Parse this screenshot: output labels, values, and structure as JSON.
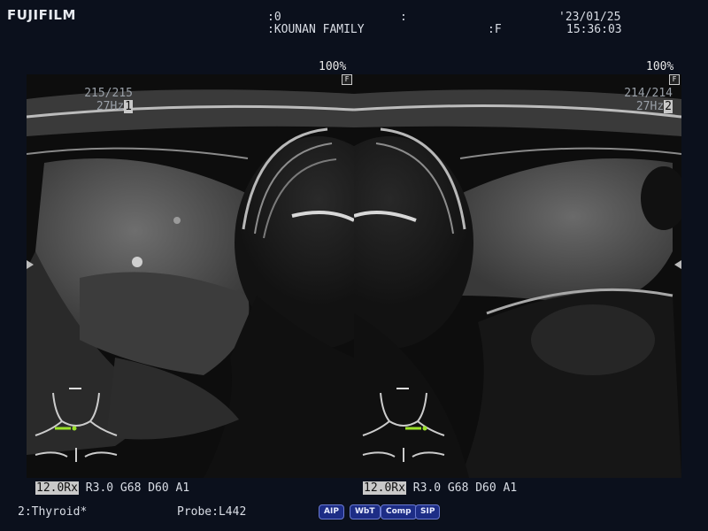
{
  "brand": "FUJIFILM",
  "header": {
    "id_value": ":0",
    "colon_mark": ":",
    "patient_name": ":KOUNAN FAMILY",
    "sex": ":F",
    "date": "'23/01/25",
    "time": "15:36:03"
  },
  "panes": [
    {
      "zoom": "100%",
      "f_marker": "F",
      "frame": "215/215",
      "rate": "27Hz",
      "index": "1",
      "params_highlight": "12.0Rx",
      "params": " R3.0 G68 D60 A1"
    },
    {
      "zoom": "100%",
      "f_marker": "F",
      "frame": "214/214",
      "rate": "27Hz",
      "index": "2",
      "params_highlight": "12.0Rx",
      "params": " R3.0 G68 D60 A1"
    }
  ],
  "footer": {
    "preset": "2:Thyroid*",
    "probe": "Probe:L442",
    "chips": [
      "AIP",
      "WbT",
      "Comp",
      "SIP"
    ]
  },
  "colors": {
    "background": "#0b101c",
    "chip": "#1d2d86",
    "bodymark_probe": "#9be22a"
  },
  "icons": [
    "neck-bodymark-icon",
    "probe-position-icon",
    "focus-marker-icon"
  ]
}
